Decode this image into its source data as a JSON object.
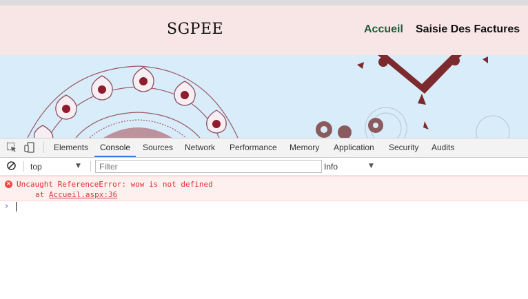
{
  "site": {
    "brand": "SGPEE",
    "nav": [
      "Accueil",
      "Saisie Des Factures"
    ],
    "colors": {
      "header_bg": "#f8e6e7",
      "banner_bg": "#d9ecf9",
      "active_nav": "#1d5c3a"
    }
  },
  "devtools": {
    "tabs": [
      {
        "label": "Elements"
      },
      {
        "label": "Console",
        "active": true
      },
      {
        "label": "Sources"
      },
      {
        "label": "Network"
      },
      {
        "label": "Performance"
      },
      {
        "label": "Memory"
      },
      {
        "label": "Application"
      },
      {
        "label": "Security"
      },
      {
        "label": "Audits"
      }
    ],
    "toolbar": {
      "context": "top",
      "filter_placeholder": "Filter",
      "level": "Info"
    },
    "console": {
      "error_message": "Uncaught ReferenceError: wow is not defined",
      "error_at_prefix": "at",
      "error_at_link": "Accueil.aspx:36",
      "prompt_symbol": "›"
    },
    "colors": {
      "accent": "#3879d9",
      "error": "#e22c2c"
    }
  }
}
